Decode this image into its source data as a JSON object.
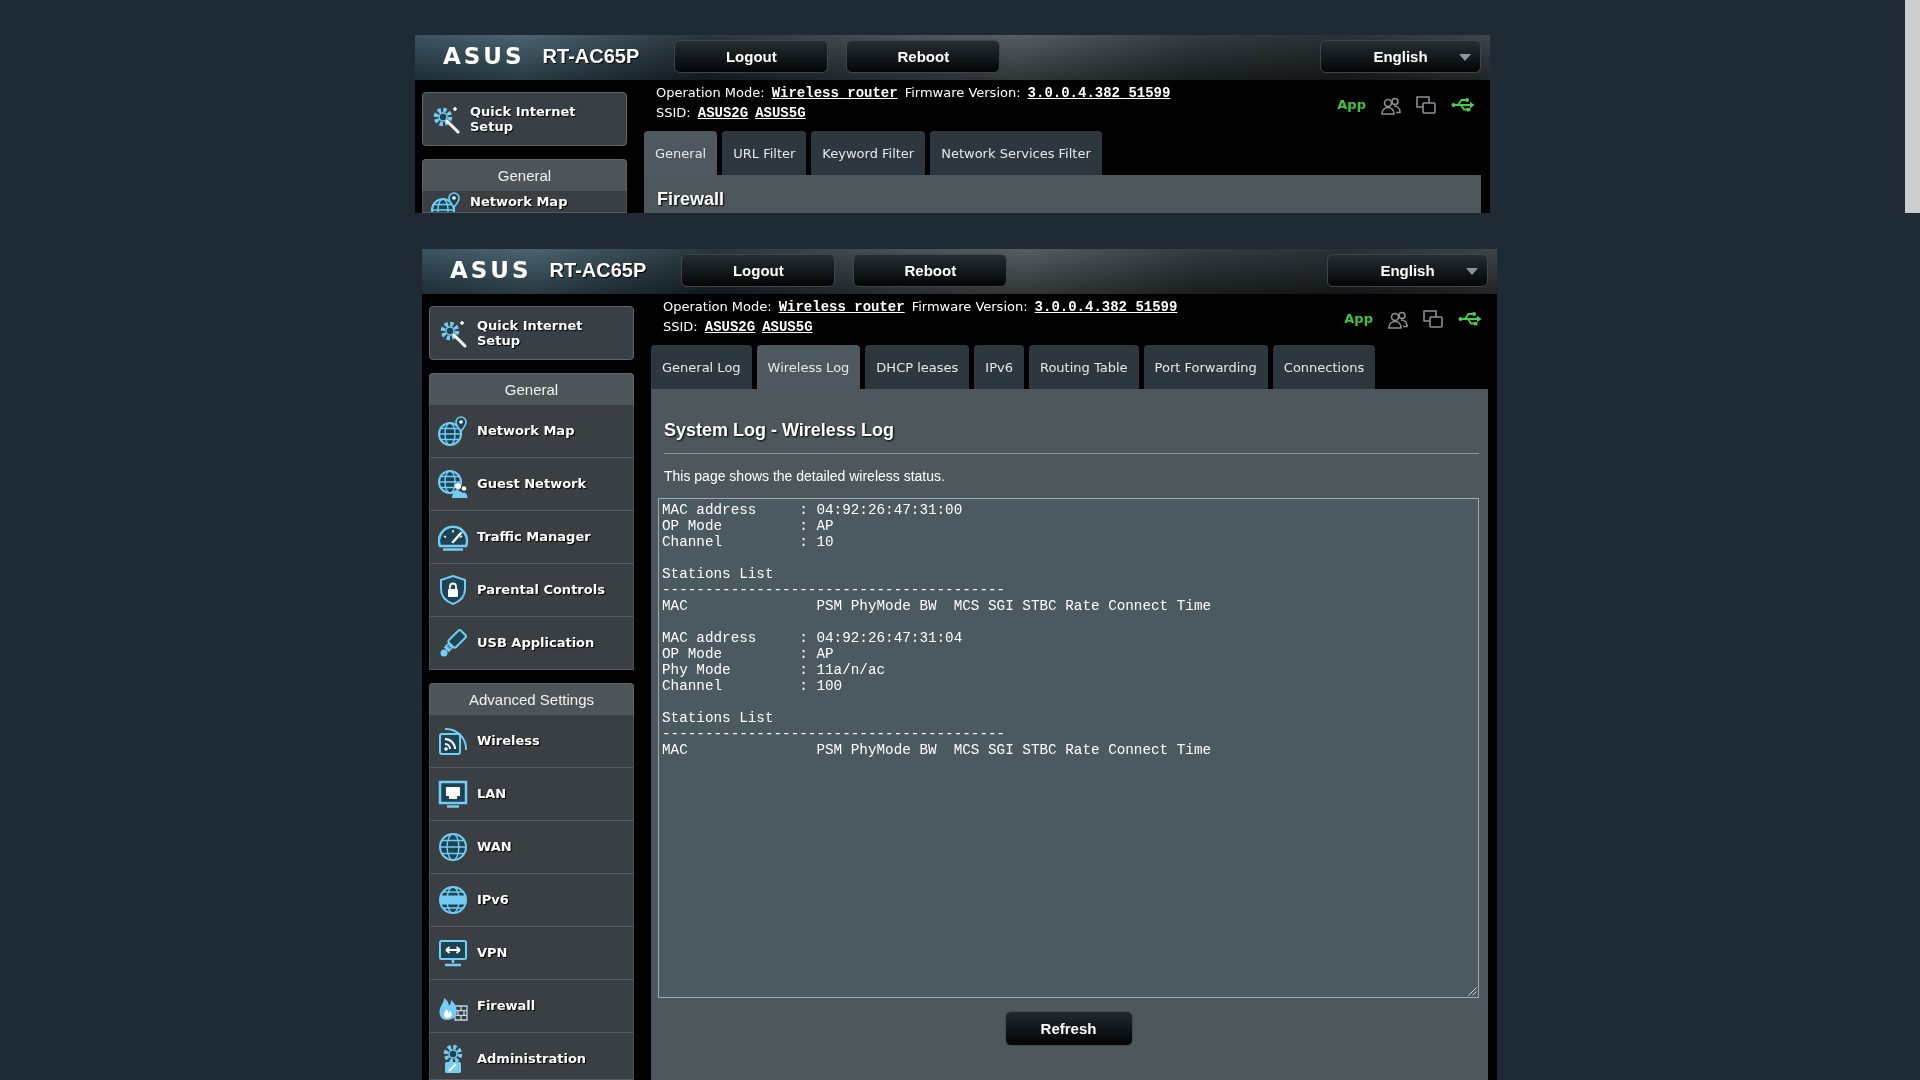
{
  "screens": [
    {
      "header": {
        "logo": "ASUS",
        "model": "RT-AC65P",
        "buttons": [
          "Logout",
          "Reboot"
        ],
        "language": "English"
      },
      "info": {
        "mode_label": "Operation Mode:",
        "mode": "Wireless router",
        "firmware_label": "Firmware Version:",
        "firmware": "3.0.0.4.382_51599",
        "ssid_label": "SSID:",
        "ssids": [
          "ASUS2G",
          "ASUS5G"
        ],
        "app": "App"
      },
      "sidebar": {
        "quick_setup": "Quick Internet Setup",
        "sections": [
          {
            "title": "General",
            "items": [
              {
                "kind": "networkmap",
                "label": "Network Map",
                "selected": false
              }
            ]
          }
        ]
      },
      "tabs": [
        {
          "label": "General",
          "selected": true
        },
        {
          "label": "URL Filter",
          "selected": false
        },
        {
          "label": "Keyword Filter",
          "selected": false
        },
        {
          "label": "Network Services Filter",
          "selected": false
        }
      ],
      "content": {
        "title": "Firewall"
      }
    },
    {
      "header": {
        "logo": "ASUS",
        "model": "RT-AC65P",
        "buttons": [
          "Logout",
          "Reboot"
        ],
        "language": "English"
      },
      "info": {
        "mode_label": "Operation Mode:",
        "mode": "Wireless router",
        "firmware_label": "Firmware Version:",
        "firmware": "3.0.0.4.382_51599",
        "ssid_label": "SSID:",
        "ssids": [
          "ASUS2G",
          "ASUS5G"
        ],
        "app": "App"
      },
      "sidebar": {
        "quick_setup": "Quick Internet Setup",
        "sections": [
          {
            "title": "General",
            "items": [
              {
                "kind": "networkmap",
                "label": "Network Map",
                "selected": false
              },
              {
                "kind": "guestnetwork",
                "label": "Guest Network",
                "selected": false
              },
              {
                "kind": "trafficmanager",
                "label": "Traffic Manager",
                "selected": false
              },
              {
                "kind": "parentalcontrols",
                "label": "Parental Controls",
                "selected": false
              },
              {
                "kind": "usbapplication",
                "label": "USB Application",
                "selected": false
              }
            ]
          },
          {
            "title": "Advanced Settings",
            "items": [
              {
                "kind": "wireless",
                "label": "Wireless",
                "selected": false
              },
              {
                "kind": "lan",
                "label": "LAN",
                "selected": false
              },
              {
                "kind": "wan",
                "label": "WAN",
                "selected": false
              },
              {
                "kind": "ipv6",
                "label": "IPv6",
                "selected": false
              },
              {
                "kind": "vpn",
                "label": "VPN",
                "selected": false
              },
              {
                "kind": "firewall",
                "label": "Firewall",
                "selected": false
              },
              {
                "kind": "administration",
                "label": "Administration",
                "selected": false
              }
            ]
          }
        ]
      },
      "tabs": [
        {
          "label": "General Log",
          "selected": false
        },
        {
          "label": "Wireless Log",
          "selected": true
        },
        {
          "label": "DHCP leases",
          "selected": false
        },
        {
          "label": "IPv6",
          "selected": false
        },
        {
          "label": "Routing Table",
          "selected": false
        },
        {
          "label": "Port Forwarding",
          "selected": false
        },
        {
          "label": "Connections",
          "selected": false
        }
      ],
      "content": {
        "title": "System Log - Wireless Log",
        "description": "This page shows the detailed wireless status.",
        "log": [
          [
            "MAC address     : 04:92:26:47:31:00",
            "OP Mode         : AP",
            "Channel         : 10"
          ],
          [
            "Stations List",
            "----------------------------------------",
            "MAC               PSM PhyMode BW  MCS SGI STBC Rate Connect Time"
          ],
          [
            "MAC address     : 04:92:26:47:31:04",
            "OP Mode         : AP",
            "Phy Mode        : 11a/n/ac",
            "Channel         : 100"
          ],
          [
            "Stations List",
            "----------------------------------------",
            "MAC               PSM PhyMode BW  MCS SGI STBC Rate Connect Time"
          ]
        ],
        "button": "Refresh"
      }
    }
  ]
}
